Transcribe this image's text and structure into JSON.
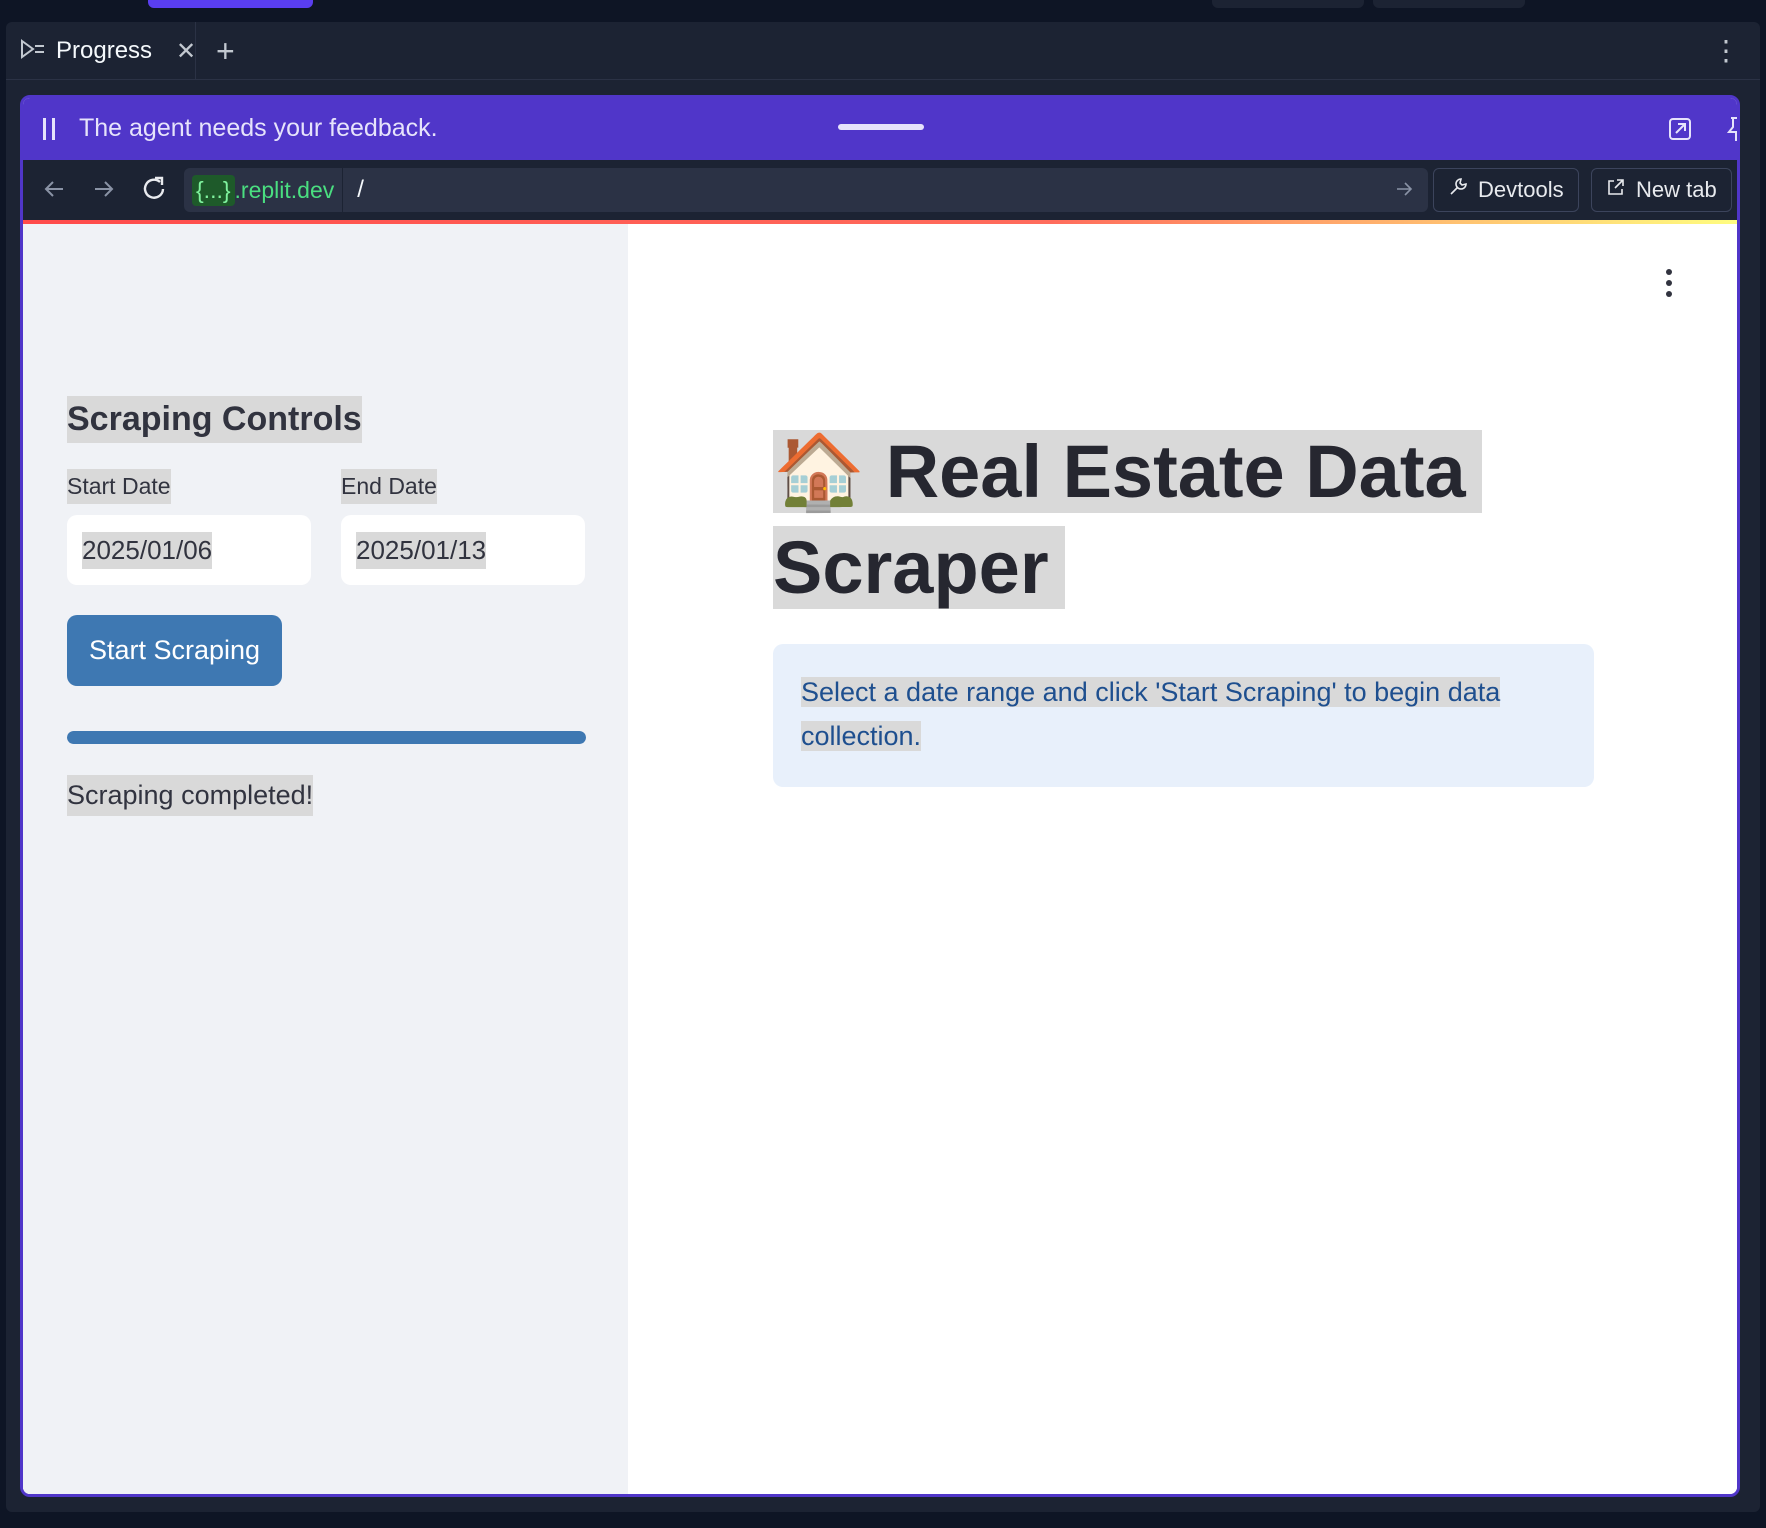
{
  "tabbar": {
    "tab_label": "Progress",
    "close_glyph": "✕",
    "add_glyph": "+",
    "more_glyph": "⋮"
  },
  "feedback_banner": {
    "text": "The agent needs your feedback."
  },
  "urlbar": {
    "host_braces": "{...}",
    "host_domain": ".replit.dev",
    "path": "/",
    "devtools_label": "Devtools",
    "new_tab_label": "New tab"
  },
  "sidebar": {
    "title": "Scraping Controls",
    "start_date_label": "Start Date",
    "start_date_value": "2025/01/06",
    "end_date_label": "End Date",
    "end_date_value": "2025/01/13",
    "start_button_label": "Start Scraping",
    "progress_fraction": 1.0,
    "status_text": "Scraping completed!"
  },
  "main": {
    "title_emoji": "🏠",
    "title_text": "Real Estate Data Scraper",
    "info_text": "Select a date range and click 'Start Scraping' to begin data collection."
  },
  "colors": {
    "banner": "#5036c9",
    "primary_button": "#3e78b2",
    "info_text": "#1e4f8f",
    "url_host": "#4ade80"
  }
}
